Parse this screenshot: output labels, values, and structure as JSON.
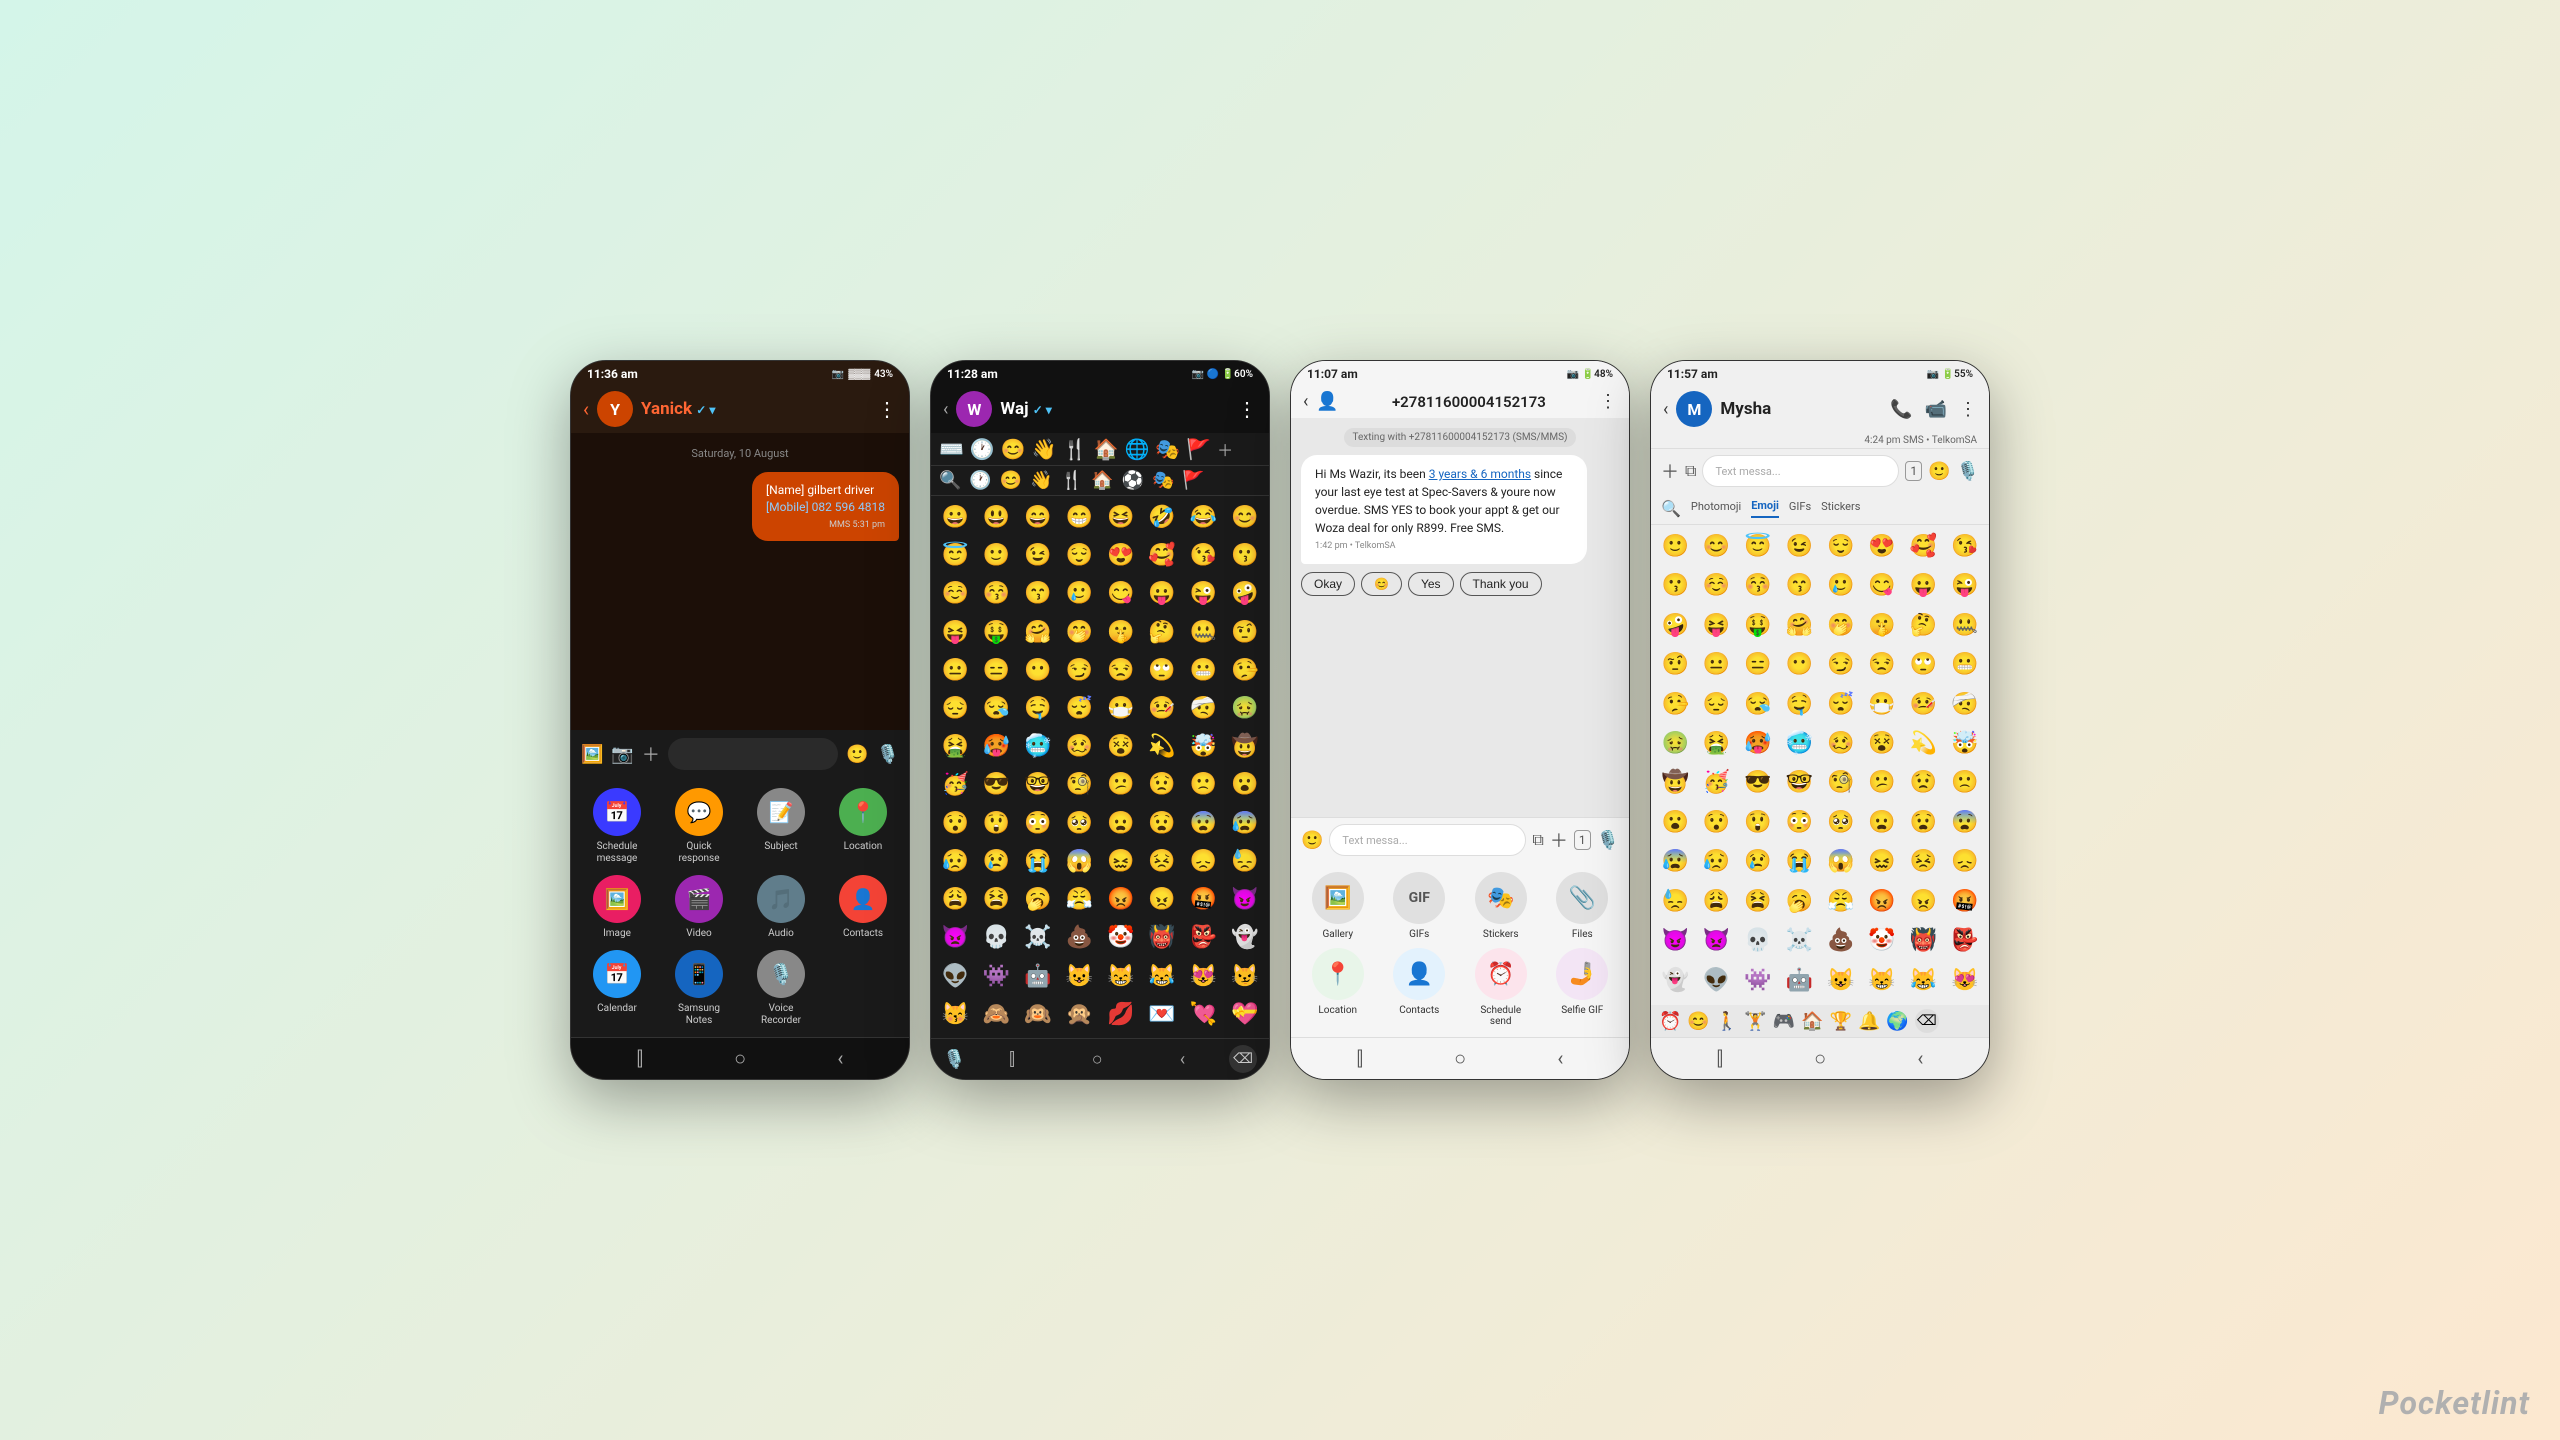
{
  "watermark": "Pocketlint",
  "phone1": {
    "status_bar": {
      "time": "11:36 am",
      "icons": "📷 🔋43%"
    },
    "contact": "Yanick",
    "contact_initial": "Y",
    "date_label": "Saturday, 10 August",
    "message": {
      "label_name": "[Name] gilbert driver",
      "label_mobile": "[Mobile] 082 596 4818",
      "type": "MMS",
      "time": "5:31 pm"
    },
    "actions": [
      {
        "icon": "📅",
        "label": "Schedule\nmessage",
        "bg": "#3a3aff"
      },
      {
        "icon": "💬",
        "label": "Quick\nresponse",
        "bg": "#ff9900"
      },
      {
        "icon": "📝",
        "label": "Subject",
        "bg": "#aaaaaa"
      },
      {
        "icon": "📍",
        "label": "Location",
        "bg": "#4caf50"
      },
      {
        "icon": "🖼️",
        "label": "Image",
        "bg": "#e91e63"
      },
      {
        "icon": "🎬",
        "label": "Video",
        "bg": "#9c27b0"
      },
      {
        "icon": "🎵",
        "label": "Audio",
        "bg": "#607d8b"
      },
      {
        "icon": "👤",
        "label": "Contacts",
        "bg": "#f44336"
      },
      {
        "icon": "📅",
        "label": "Calendar",
        "bg": "#2196f3"
      },
      {
        "icon": "📱",
        "label": "Samsung\nNotes",
        "bg": "#1565c0"
      },
      {
        "icon": "🎙️",
        "label": "Voice\nRecorder",
        "bg": "#888"
      }
    ]
  },
  "phone2": {
    "status_bar": {
      "time": "11:28 am",
      "icons": "📷 🔵 🔋60%"
    },
    "contact": "Waj",
    "contact_initial": "W",
    "emojis": [
      "😀",
      "😃",
      "😄",
      "😁",
      "😆",
      "🤣",
      "😂",
      "😊",
      "😇",
      "🙂",
      "😉",
      "😌",
      "😍",
      "🥰",
      "😘",
      "😗",
      "☺️",
      "😚",
      "😙",
      "🥲",
      "😋",
      "😛",
      "😜",
      "🤪",
      "😝",
      "🤑",
      "🤗",
      "🤭",
      "🤫",
      "🤔",
      "🤐",
      "🤨",
      "😐",
      "😑",
      "😶",
      "😏",
      "😒",
      "🙄",
      "😬",
      "🤥",
      "😔",
      "😪",
      "🤤",
      "😴",
      "😷",
      "🤒",
      "🤕",
      "🤢",
      "🤮",
      "🥵",
      "🥶",
      "🥴",
      "😵",
      "💫",
      "🤯",
      "🤠",
      "🥳",
      "😎",
      "🤓",
      "🧐",
      "😕",
      "😟",
      "🙁",
      "😮",
      "😯",
      "😲",
      "😳",
      "🥺",
      "😦",
      "😧",
      "😨",
      "😰",
      "😥",
      "😢",
      "😭",
      "😱",
      "😖",
      "😣",
      "😞",
      "😓",
      "😩",
      "😫",
      "🥱",
      "😤",
      "😡",
      "😠",
      "🤬",
      "😈",
      "👿",
      "💀",
      "☠️",
      "💩",
      "🤡",
      "👹",
      "👺",
      "👻",
      "👽",
      "👾",
      "🤖",
      "😺",
      "😸",
      "😹",
      "😻",
      "😼",
      "😽",
      "🙈",
      "🙉",
      "🙊",
      "💋",
      "💌",
      "💘",
      "💝"
    ]
  },
  "phone3": {
    "status_bar": {
      "time": "11:07 am",
      "icons": "🔋48%"
    },
    "contact_number": "+27811600004152173",
    "sms_info": "Texting with +27811600004152173 (SMS/MMS)",
    "message_text": "Hi Ms Wazir, its been 3 years & 6 months since your last eye test at Spec-Savers & youre now overdue. SMS YES to book your appt & get our Woza deal for only R899. Free SMS.",
    "message_time": "1:42 pm • TelkomSA",
    "quick_replies": [
      "Okay",
      "😊",
      "Yes",
      "Thank you"
    ],
    "input_placeholder": "Text messa...",
    "media_items": [
      {
        "icon": "🖼️",
        "label": "Gallery",
        "bg": "#e0e0e0"
      },
      {
        "icon": "GIF",
        "label": "GIFs",
        "bg": "#e0e0e0"
      },
      {
        "icon": "🎭",
        "label": "Stickers",
        "bg": "#e0e0e0"
      },
      {
        "icon": "📎",
        "label": "Files",
        "bg": "#e0e0e0"
      },
      {
        "icon": "📍",
        "label": "Location",
        "bg": "#e0e0e0"
      },
      {
        "icon": "👤",
        "label": "Contacts",
        "bg": "#e0e0e0"
      },
      {
        "icon": "⏰",
        "label": "Schedule\nsend",
        "bg": "#e0e0e0"
      },
      {
        "icon": "🤳",
        "label": "Selfie GIF",
        "bg": "#e0e0e0"
      }
    ]
  },
  "phone4": {
    "status_bar": {
      "time": "11:57 am",
      "icons": "📷 🔋55%"
    },
    "contact": "Mysha",
    "contact_initial": "M",
    "chat_header": "4:24 pm SMS • TelkomSA",
    "input_placeholder": "Text messa...",
    "emoji_tabs": [
      "Photomoji",
      "Emoji",
      "GIFs",
      "Stickers"
    ],
    "active_tab": "Emoji",
    "emojis": [
      "🙂",
      "😊",
      "😇",
      "😉",
      "😌",
      "😍",
      "🥰",
      "😘",
      "😗",
      "☺️",
      "😚",
      "😙",
      "🥲",
      "😋",
      "😛",
      "😜",
      "🤪",
      "😝",
      "🤑",
      "🤗",
      "🤭",
      "🤫",
      "🤔",
      "🤐",
      "🤨",
      "😐",
      "😑",
      "😶",
      "😏",
      "😒",
      "🙄",
      "😬",
      "🤥",
      "😔",
      "😪",
      "🤤",
      "😴",
      "😷",
      "🤒",
      "🤕",
      "🤢",
      "🤮",
      "🥵",
      "🥶",
      "🥴",
      "😵",
      "💫",
      "🤯",
      "🤠",
      "🥳",
      "😎",
      "🤓",
      "🧐",
      "😕",
      "😟",
      "🙁",
      "😮",
      "😯",
      "😲",
      "😳",
      "🥺",
      "😦",
      "😧",
      "😨",
      "😰",
      "😥",
      "😢",
      "😭",
      "😱",
      "😖",
      "😣",
      "😞",
      "😓",
      "😩",
      "😫",
      "🥱",
      "😤",
      "😡",
      "😠",
      "🤬",
      "😈",
      "👿",
      "💀",
      "☠️",
      "💩",
      "🤡",
      "👹",
      "👺",
      "👻",
      "👽",
      "👾",
      "🤖",
      "😺",
      "😸",
      "😹",
      "😻"
    ],
    "bottom_emojis": [
      "⏰",
      "😊",
      "🚶",
      "🏋️",
      "🎮",
      "🏠",
      "🏆",
      "🔔",
      "🌍",
      "❌"
    ]
  }
}
